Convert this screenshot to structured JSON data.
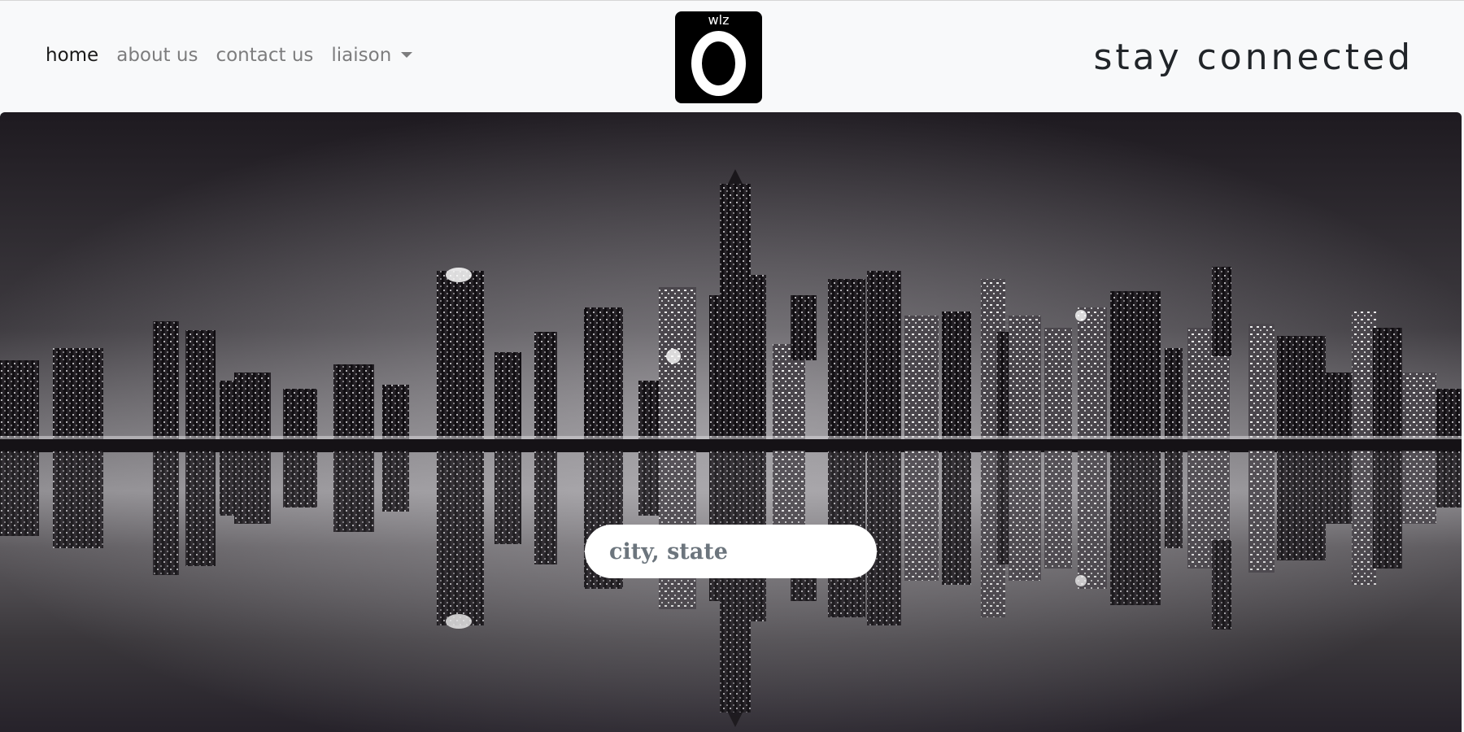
{
  "nav": {
    "links": [
      {
        "label": "home",
        "active": true
      },
      {
        "label": "about us",
        "active": false
      },
      {
        "label": "contact us",
        "active": false
      },
      {
        "label": "liaison",
        "active": false,
        "dropdown": true
      }
    ],
    "brand": {
      "small_text": "wlz",
      "icon": "ring-logo-icon"
    },
    "tagline": "stay connected"
  },
  "hero": {
    "image": "city-skyline-reflection-night",
    "search": {
      "placeholder": "city, state",
      "value": ""
    }
  },
  "colors": {
    "navbar_bg": "#f8f9fa",
    "brand_bg": "#000000",
    "text_dark": "#212529",
    "text_muted": "#6c757d"
  }
}
